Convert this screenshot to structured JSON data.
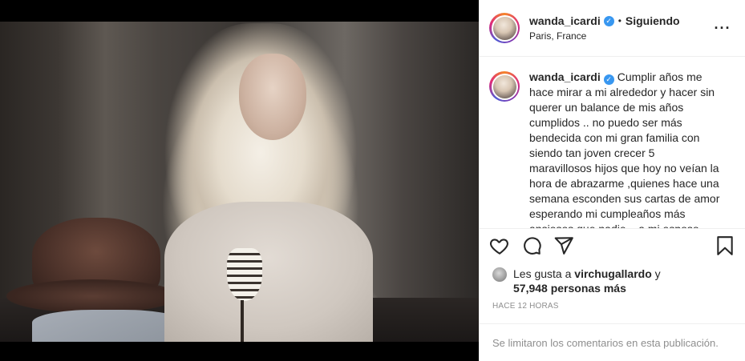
{
  "post": {
    "username": "wanda_icardi",
    "verified": true,
    "separator": "•",
    "follow_status": "Siguiendo",
    "location": "Paris, France",
    "more_icon": "more-horizontal-icon"
  },
  "caption": {
    "username": "wanda_icardi",
    "text": "Cumplir años me hace mirar a mi alrededor y hacer sin querer un balance de mis años cumplidos .. no puedo ser más bendecida con mi gran familia con siendo tan joven crecer 5 maravillosos hijos que hoy no veían la hora de abrazarme ,quienes hace una semana esconden sus cartas de amor esperando mi cumpleaños más ansiosos que nadie .. a mi esposo que"
  },
  "actions": {
    "like_icon": "heart-icon",
    "comment_icon": "comment-icon",
    "share_icon": "share-icon",
    "save_icon": "bookmark-icon"
  },
  "likes": {
    "prefix": "Les gusta a",
    "user": "virchugallardo",
    "joiner": "y",
    "count": "57,948 personas más"
  },
  "timestamp": "HACE 12 HORAS",
  "comments_limited": "Se limitaron los comentarios en esta publicación.",
  "colors": {
    "verified": "#3897f0",
    "text": "#262626",
    "muted": "#8e8e8e",
    "border": "#efefef"
  }
}
